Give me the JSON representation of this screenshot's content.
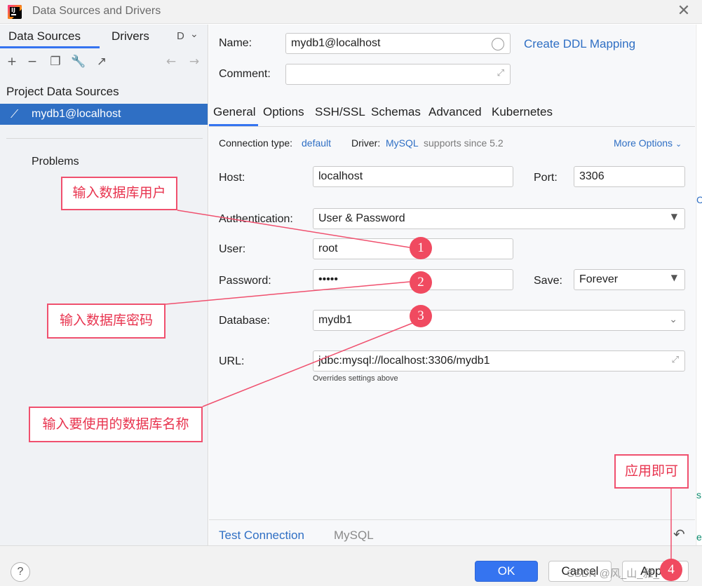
{
  "window": {
    "title": "Data Sources and Drivers",
    "close_icon": "close-icon"
  },
  "left": {
    "tabs": [
      "Data Sources",
      "Drivers",
      "D"
    ],
    "section_title": "Project Data Sources",
    "selected_item": "mydb1@localhost",
    "problems": "Problems"
  },
  "form": {
    "name_label": "Name:",
    "name_value": "mydb1@localhost",
    "ddl_link": "Create DDL Mapping",
    "comment_label": "Comment:",
    "comment_value": "",
    "tabs": [
      "General",
      "Options",
      "SSH/SSL",
      "Schemas",
      "Advanced",
      "Kubernetes"
    ],
    "conn_type_label": "Connection type:",
    "conn_type_value": "default",
    "driver_label": "Driver:",
    "driver_value": "MySQL",
    "driver_note": "supports since 5.2",
    "more_options": "More Options",
    "host_label": "Host:",
    "host_value": "localhost",
    "port_label": "Port:",
    "port_value": "3306",
    "auth_label": "Authentication:",
    "auth_value": "User & Password",
    "user_label": "User:",
    "user_value": "root",
    "password_label": "Password:",
    "password_value": "•••••",
    "save_label": "Save:",
    "save_value": "Forever",
    "database_label": "Database:",
    "database_value": "mydb1",
    "url_label": "URL:",
    "url_value": "jdbc:mysql://localhost:3306/mydb1",
    "url_note": "Overrides settings above",
    "test_connection": "Test Connection",
    "driver_footer": "MySQL"
  },
  "buttons": {
    "help": "?",
    "ok": "OK",
    "cancel": "Cancel",
    "apply": "Apply"
  },
  "watermark": "CSDN @风_山_雅_平~",
  "annotations": {
    "user_note": "输入数据库用户",
    "password_note": "输入数据库密码",
    "database_note": "输入要使用的数据库名称",
    "apply_note": "应用即可",
    "markers": [
      "1",
      "2",
      "3",
      "4"
    ]
  },
  "colors": {
    "accent": "#3574f0",
    "selection": "#2f6fc4",
    "annotation": "#f0506e"
  }
}
